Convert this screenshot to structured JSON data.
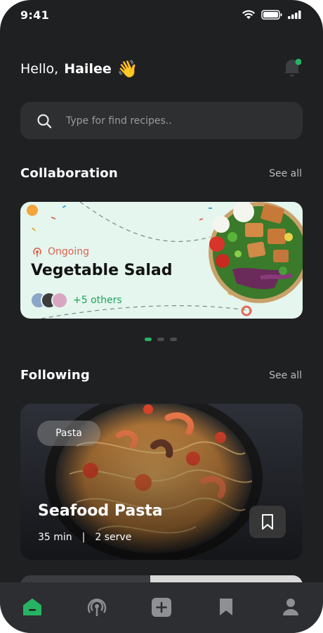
{
  "status": {
    "time": "9:41"
  },
  "header": {
    "greeting": "Hello,",
    "name": "Hailee",
    "wave": "👋"
  },
  "search": {
    "placeholder": "Type for find recipes.."
  },
  "collaboration": {
    "title": "Collaboration",
    "see_all": "See all",
    "card": {
      "status": "Ongoing",
      "recipe": "Vegetable Salad",
      "others": "+5 others"
    },
    "pager": {
      "count": 3,
      "active": 0
    }
  },
  "following": {
    "title": "Following",
    "see_all": "See all",
    "card": {
      "tag": "Pasta",
      "recipe": "Seafood Pasta",
      "time": "35 min",
      "separator": "|",
      "serve": "2 serve"
    }
  },
  "tabs": [
    {
      "name": "home",
      "icon": "home-icon",
      "active": true
    },
    {
      "name": "live",
      "icon": "broadcast-icon",
      "active": false
    },
    {
      "name": "add",
      "icon": "plus-icon",
      "active": false
    },
    {
      "name": "saved",
      "icon": "bookmark-icon",
      "active": false
    },
    {
      "name": "profile",
      "icon": "user-icon",
      "active": false
    }
  ],
  "colors": {
    "accent": "#27b364",
    "background": "#1f2022",
    "card_bg": "#e4f6ee",
    "ongoing": "#e0604e"
  }
}
